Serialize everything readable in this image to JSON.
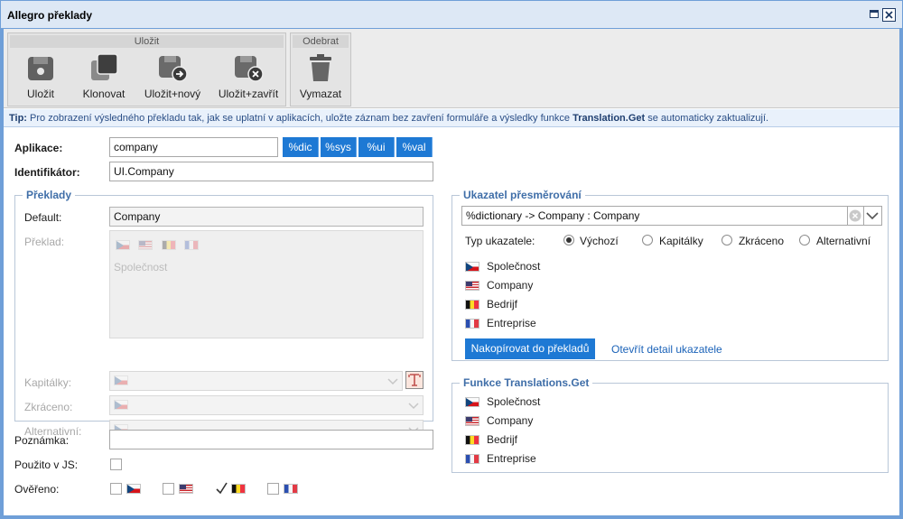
{
  "window": {
    "title": "Allegro překlady"
  },
  "ribbon": {
    "groups": [
      {
        "title": "Uložit"
      },
      {
        "title": "Odebrat"
      }
    ],
    "buttons": {
      "save": "Uložit",
      "clone": "Klonovat",
      "save_new": "Uložit+nový",
      "save_close": "Uložit+zavřít",
      "delete": "Vymazat"
    }
  },
  "tip": {
    "prefix": "Tip:",
    "text_before": "Pro zobrazení výsledného překladu tak, jak se uplatní v aplikacích, uložte záznam bez zavření formuláře a výsledky funkce",
    "function_name": "Translation.Get",
    "text_after": "se automaticky zaktualizují."
  },
  "form": {
    "application_label": "Aplikace:",
    "application_value": "company",
    "macros": [
      "%dic",
      "%sys",
      "%ui",
      "%val"
    ],
    "identifier_label": "Identifikátor:",
    "identifier_value": "UI.Company"
  },
  "translations": {
    "legend": "Překlady",
    "default_label": "Default:",
    "default_value": "Company",
    "translation_label": "Překlad:",
    "translation_text": "Společnost",
    "capitals_label": "Kapitálky:",
    "abbreviated_label": "Zkráceno:",
    "alternative_label": "Alternativní:"
  },
  "note": {
    "label": "Poznámka:",
    "value": ""
  },
  "used_in_js": {
    "label": "Použito v JS:",
    "checked": false
  },
  "verified": {
    "label": "Ověřeno:",
    "items": [
      {
        "flag": "cz-flag-icon",
        "checked": false
      },
      {
        "flag": "us-flag-icon",
        "checked": false
      },
      {
        "flag": "be-flag-icon",
        "checked": true
      },
      {
        "flag": "fr-flag-icon",
        "checked": false
      }
    ]
  },
  "pointer": {
    "legend": "Ukazatel přesměrování",
    "select_value": "%dictionary -> Company : Company",
    "type_label": "Typ ukazatele:",
    "types": [
      "Výchozí",
      "Kapitálky",
      "Zkráceno",
      "Alternativní"
    ],
    "selected_type": "Výchozí",
    "translations": [
      {
        "flag": "cz-flag-icon",
        "text": "Společnost"
      },
      {
        "flag": "us-flag-icon",
        "text": "Company"
      },
      {
        "flag": "be-flag-icon",
        "text": "Bedrijf"
      },
      {
        "flag": "fr-flag-icon",
        "text": "Entreprise"
      }
    ],
    "copy_button": "Nakopírovat do překladů",
    "open_link": "Otevřít detail ukazatele"
  },
  "function_result": {
    "legend": "Funkce Translations.Get",
    "rows": [
      {
        "flag": "cz-flag-icon",
        "text": "Společnost"
      },
      {
        "flag": "us-flag-icon",
        "text": "Company"
      },
      {
        "flag": "be-flag-icon",
        "text": "Bedrijf"
      },
      {
        "flag": "fr-flag-icon",
        "text": "Entreprise"
      }
    ]
  },
  "colors": {
    "accent": "#1e79d4",
    "frame": "#6f9fd8",
    "legend": "#3f6ea8",
    "tip_text": "#2a4e86"
  }
}
